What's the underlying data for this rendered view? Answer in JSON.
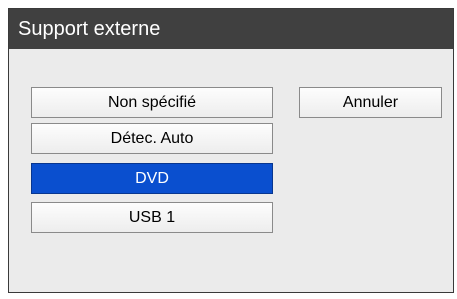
{
  "dialog": {
    "title": "Support externe",
    "options": [
      {
        "label": "Non spécifié",
        "selected": false
      },
      {
        "label": "Détec. Auto",
        "selected": false
      },
      {
        "label": "DVD",
        "selected": true
      },
      {
        "label": "USB 1",
        "selected": false
      }
    ],
    "cancel_label": "Annuler"
  },
  "colors": {
    "titlebar": "#404040",
    "body": "#ebebeb",
    "selected": "#0a4fcf"
  }
}
